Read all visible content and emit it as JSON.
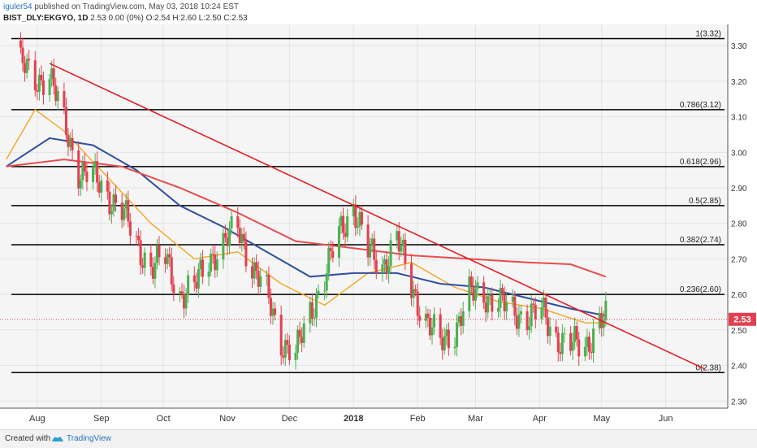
{
  "header": {
    "author": "iguler54",
    "published_text": "published on TradingView.com, May 03, 2018 10:24 EST",
    "symbol": "BIST_DLY:EKGYO, 1D",
    "ohlc_text": "2.53 0.00 (0%) O:2.54 H:2.60 L:2.50 C:2.53"
  },
  "footer": {
    "created_with": "Created with",
    "brand": "TradingView"
  },
  "colors": {
    "up": "#4caf50",
    "down": "#e2404f",
    "fib": "#000000",
    "trend": "#e01e26",
    "ma_short": "#f5a623",
    "ma_mid": "#2f4f9e",
    "ma_long": "#e84c4c",
    "bg": "#f5f5f5"
  },
  "chart_data": {
    "type": "candlestick",
    "title": "",
    "xlabel": "",
    "ylabel": "",
    "ylim": [
      2.28,
      3.36
    ],
    "x_ticks": [
      "Aug",
      "Sep",
      "Oct",
      "Nov",
      "Dec",
      "2018",
      "Feb",
      "Mar",
      "Apr",
      "May",
      "Jun"
    ],
    "y_ticks": [
      "3.30",
      "3.20",
      "3.10",
      "3.00",
      "2.90",
      "2.80",
      "2.70",
      "2.60",
      "2.50",
      "2.40",
      "2.30"
    ],
    "last_price": {
      "label": "2.53",
      "value": 2.53
    },
    "fib_levels": [
      {
        "label": "1(3.32)",
        "value": 3.32
      },
      {
        "label": "0.786(3.12)",
        "value": 3.12
      },
      {
        "label": "0.618(2.96)",
        "value": 2.96
      },
      {
        "label": "0.5(2.85)",
        "value": 2.85
      },
      {
        "label": "0.382(2.74)",
        "value": 2.74
      },
      {
        "label": "0.236(2.60)",
        "value": 2.6
      },
      {
        "label": "0(2.38)",
        "value": 2.38
      }
    ],
    "trendline": {
      "from": [
        "2017-08-07",
        3.25
      ],
      "to": [
        "2018-06-20",
        2.39
      ]
    },
    "candle_close_anchors": [
      [
        "2017-07-24",
        3.25
      ],
      [
        "2017-07-31",
        3.2
      ],
      [
        "2017-08-07",
        3.22
      ],
      [
        "2017-08-14",
        3.08
      ],
      [
        "2017-08-21",
        2.95
      ],
      [
        "2017-08-28",
        2.93
      ],
      [
        "2017-09-04",
        2.88
      ],
      [
        "2017-09-11",
        2.84
      ],
      [
        "2017-09-18",
        2.74
      ],
      [
        "2017-09-25",
        2.68
      ],
      [
        "2017-10-02",
        2.7
      ],
      [
        "2017-10-09",
        2.6
      ],
      [
        "2017-10-16",
        2.62
      ],
      [
        "2017-10-23",
        2.7
      ],
      [
        "2017-10-30",
        2.74
      ],
      [
        "2017-11-06",
        2.79
      ],
      [
        "2017-11-13",
        2.68
      ],
      [
        "2017-11-20",
        2.6
      ],
      [
        "2017-11-27",
        2.47
      ],
      [
        "2017-12-04",
        2.43
      ],
      [
        "2017-12-11",
        2.55
      ],
      [
        "2017-12-18",
        2.65
      ],
      [
        "2017-12-25",
        2.77
      ],
      [
        "2018-01-01",
        2.85
      ],
      [
        "2018-01-08",
        2.72
      ],
      [
        "2018-01-15",
        2.68
      ],
      [
        "2018-01-22",
        2.76
      ],
      [
        "2018-01-29",
        2.62
      ],
      [
        "2018-02-05",
        2.53
      ],
      [
        "2018-02-12",
        2.46
      ],
      [
        "2018-02-19",
        2.5
      ],
      [
        "2018-02-26",
        2.6
      ],
      [
        "2018-03-05",
        2.6
      ],
      [
        "2018-03-12",
        2.58
      ],
      [
        "2018-03-19",
        2.55
      ],
      [
        "2018-03-26",
        2.54
      ],
      [
        "2018-04-02",
        2.55
      ],
      [
        "2018-04-09",
        2.48
      ],
      [
        "2018-04-16",
        2.46
      ],
      [
        "2018-04-23",
        2.45
      ],
      [
        "2018-04-30",
        2.53
      ]
    ],
    "moving_averages": [
      {
        "points": [
          [
            "2017-07-17",
            2.98
          ],
          [
            "2017-07-31",
            3.12
          ],
          [
            "2017-08-14",
            3.06
          ],
          [
            "2017-09-04",
            2.93
          ],
          [
            "2017-09-25",
            2.8
          ],
          [
            "2017-10-16",
            2.7
          ],
          [
            "2017-11-06",
            2.72
          ],
          [
            "2017-11-27",
            2.63
          ],
          [
            "2017-12-18",
            2.57
          ],
          [
            "2018-01-08",
            2.66
          ],
          [
            "2018-01-29",
            2.69
          ],
          [
            "2018-02-19",
            2.62
          ],
          [
            "2018-03-12",
            2.58
          ],
          [
            "2018-04-02",
            2.56
          ],
          [
            "2018-04-23",
            2.52
          ],
          [
            "2018-05-03",
            2.52
          ]
        ]
      },
      {
        "points": [
          [
            "2017-07-17",
            2.96
          ],
          [
            "2017-08-07",
            3.04
          ],
          [
            "2017-08-28",
            3.02
          ],
          [
            "2017-09-18",
            2.95
          ],
          [
            "2017-10-09",
            2.85
          ],
          [
            "2017-10-30",
            2.79
          ],
          [
            "2017-11-20",
            2.72
          ],
          [
            "2017-12-11",
            2.65
          ],
          [
            "2018-01-01",
            2.66
          ],
          [
            "2018-01-22",
            2.66
          ],
          [
            "2018-02-12",
            2.63
          ],
          [
            "2018-03-05",
            2.62
          ],
          [
            "2018-03-26",
            2.59
          ],
          [
            "2018-04-16",
            2.56
          ],
          [
            "2018-05-03",
            2.54
          ]
        ]
      },
      {
        "points": [
          [
            "2017-07-17",
            2.96
          ],
          [
            "2017-08-14",
            2.98
          ],
          [
            "2017-09-11",
            2.96
          ],
          [
            "2017-10-09",
            2.9
          ],
          [
            "2017-11-06",
            2.83
          ],
          [
            "2017-12-04",
            2.75
          ],
          [
            "2018-01-01",
            2.73
          ],
          [
            "2018-01-29",
            2.71
          ],
          [
            "2018-02-26",
            2.7
          ],
          [
            "2018-03-26",
            2.69
          ],
          [
            "2018-04-16",
            2.685
          ],
          [
            "2018-05-03",
            2.65
          ]
        ]
      }
    ]
  }
}
